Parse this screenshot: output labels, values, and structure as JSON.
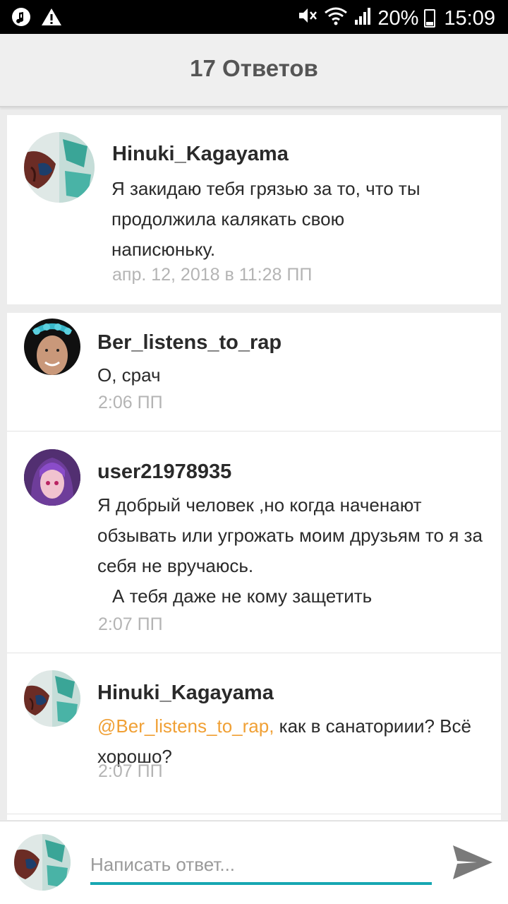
{
  "status_bar": {
    "battery": "20%",
    "time": "15:09",
    "icons": [
      "music-icon",
      "warning-icon",
      "mute-icon",
      "wifi-icon",
      "signal-icon",
      "battery-icon"
    ]
  },
  "header": {
    "title": "17 Ответов"
  },
  "parent_comment": {
    "username": "Hinuki_Kagayama",
    "text": "Я закидаю тебя грязью за то, что ты продолжила калякать свою написюньку.",
    "timestamp": "апр. 12, 2018 в 11:28 ПП"
  },
  "replies": [
    {
      "username": "Ber_listens_to_rap",
      "text": "О, срач",
      "timestamp": "2:06 ПП"
    },
    {
      "username": "user21978935",
      "text": "Я добрый человек ,но когда наченают обзывать или угрожать моим друзьям то я за себя не вручаюсь.",
      "text2": "А тебя даже не кому защетить",
      "timestamp": "2:07 ПП"
    },
    {
      "username": "Hinuki_Kagayama",
      "mention": "@Ber_listens_to_rap,",
      "text": " как в санаториии? Всё хорошо?",
      "timestamp": "2:07 ПП"
    }
  ],
  "reply_bar": {
    "placeholder": "Написать ответ..."
  },
  "colors": {
    "accent": "#17a7b2",
    "mention": "#f0a035",
    "timestamp": "#b4b4b4"
  }
}
